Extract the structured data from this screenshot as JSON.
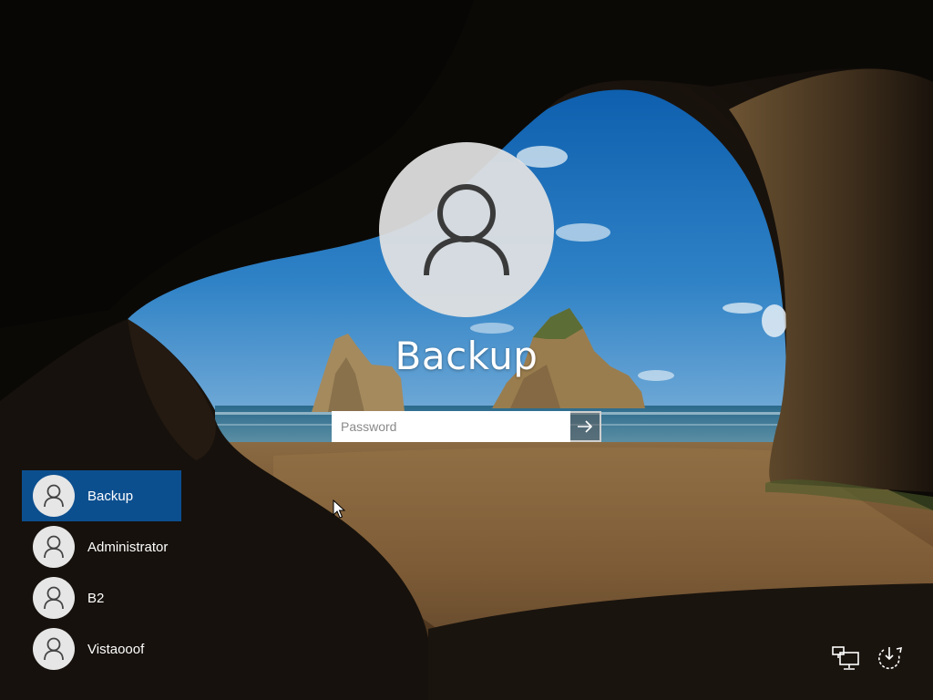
{
  "login": {
    "username": "Backup",
    "password_placeholder": "Password"
  },
  "user_list": [
    {
      "label": "Backup",
      "selected": true
    },
    {
      "label": "Administrator",
      "selected": false
    },
    {
      "label": "B2",
      "selected": false
    },
    {
      "label": "Vistaooof",
      "selected": false
    }
  ],
  "icons": {
    "user_tile": "user-silhouette-icon",
    "submit": "arrow-right-icon",
    "network": "network-icon",
    "power": "power-icon",
    "cursor": "mouse-cursor-icon"
  },
  "colors": {
    "selected_user_bg": "#0c4f8f",
    "tile_bg": "#e2e2e2"
  }
}
